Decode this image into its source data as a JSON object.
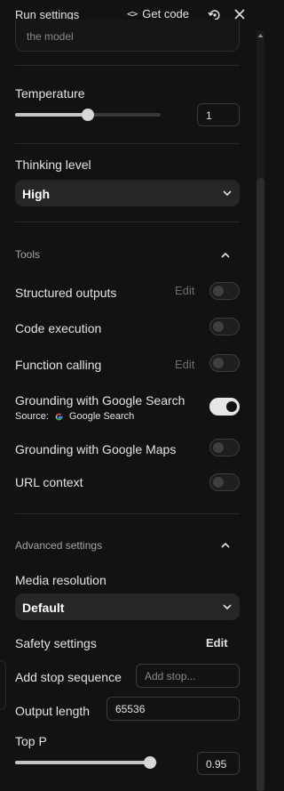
{
  "header": {
    "title": "Run settings",
    "get_code_icon": "<>",
    "get_code_label": "Get code",
    "reset_icon": "reset-icon",
    "close_icon": "close-icon"
  },
  "system_instructions": {
    "text": "the model"
  },
  "temperature": {
    "label": "Temperature",
    "value": "1",
    "fraction": 0.5
  },
  "thinking_level": {
    "label": "Thinking level",
    "selected": "High"
  },
  "tools": {
    "section_label": "Tools",
    "items": [
      {
        "label": "Structured outputs",
        "edit": "Edit",
        "enabled": false
      },
      {
        "label": "Code execution",
        "enabled": false
      },
      {
        "label": "Function calling",
        "edit": "Edit",
        "enabled": false
      },
      {
        "label": "Grounding with Google Search",
        "enabled": true,
        "source_prefix": "Source:",
        "source_name": "Google Search"
      },
      {
        "label": "Grounding with Google Maps",
        "enabled": false
      },
      {
        "label": "URL context",
        "enabled": false
      }
    ]
  },
  "advanced": {
    "section_label": "Advanced settings",
    "media_resolution": {
      "label": "Media resolution",
      "selected": "Default"
    },
    "safety": {
      "label": "Safety settings",
      "edit": "Edit"
    },
    "stop_sequence": {
      "label": "Add stop sequence",
      "placeholder": "Add stop..."
    },
    "output_length": {
      "label": "Output length",
      "value": "65536"
    },
    "top_p": {
      "label": "Top P",
      "value": "0.95",
      "fraction": 0.95
    }
  },
  "colors": {
    "background": "#121212",
    "toggle_on": "#e6e6e6",
    "text": "#e3e3e3",
    "muted": "#8a8a8a"
  }
}
